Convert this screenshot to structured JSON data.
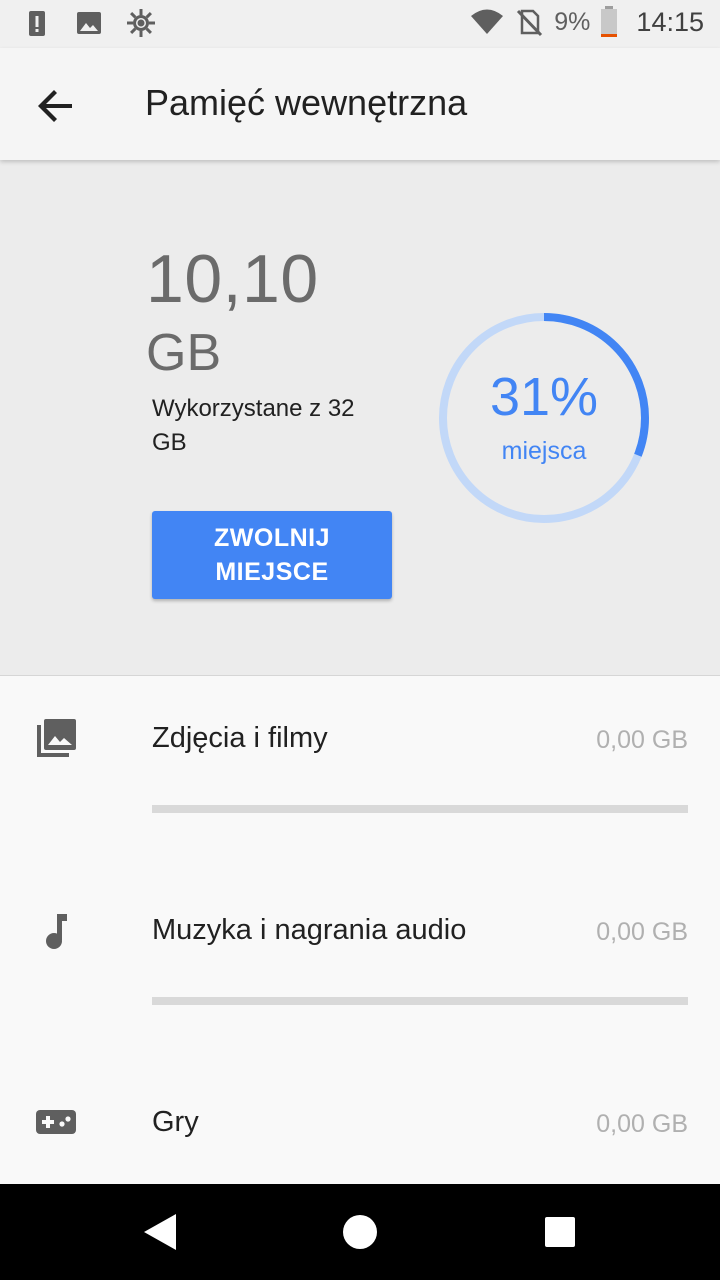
{
  "status_bar": {
    "icons_left": [
      "alert-icon",
      "image-icon",
      "brightness-icon"
    ],
    "icons_right": [
      "wifi-icon",
      "no-sim-icon",
      "battery-low-icon"
    ],
    "battery_percent": "9%",
    "time": "14:15",
    "battery_level": 0.09
  },
  "app_bar": {
    "title": "Pamięć wewnętrzna",
    "back_icon": "arrow-back-icon"
  },
  "summary": {
    "used_value": "10,10",
    "used_unit": "GB",
    "used_description": "Wykorzystane z 32 GB",
    "free_button_label": "ZWOLNIJ MIEJSCE",
    "percent_text": "31%",
    "percent_label": "miejsca",
    "percent_used": 0.31
  },
  "categories": [
    {
      "icon": "photo-library-icon",
      "label": "Zdjęcia i filmy",
      "size": "0,00 GB",
      "fraction": 0
    },
    {
      "icon": "music-note-icon",
      "label": "Muzyka i nagrania audio",
      "size": "0,00 GB",
      "fraction": 0
    },
    {
      "icon": "gamepad-icon",
      "label": "Gry",
      "size": "0,00 GB",
      "fraction": 0
    }
  ],
  "nav_bar": {
    "icons": [
      "back-triangle-icon",
      "home-circle-icon",
      "recents-square-icon"
    ]
  },
  "colors": {
    "accent": "#4285f4",
    "accent_light": "#c2d8f8",
    "battery_warning": "#e65100"
  }
}
